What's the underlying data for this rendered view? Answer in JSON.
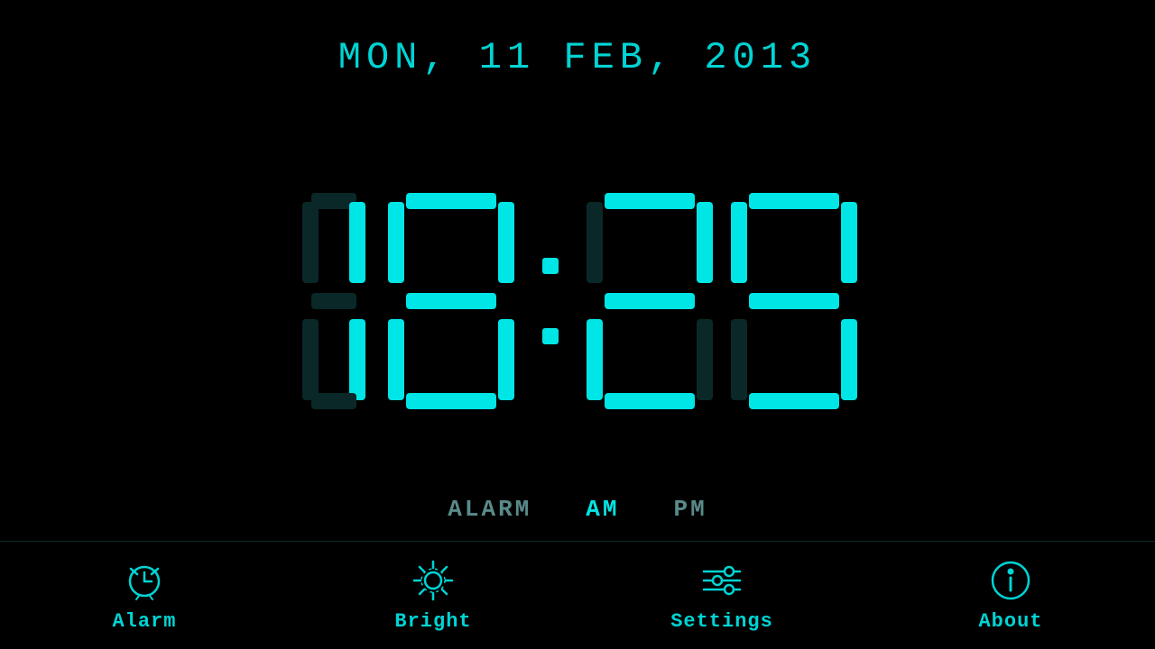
{
  "header": {
    "date": "MON,  11 FEB,  2013"
  },
  "clock": {
    "time": "18:29",
    "digits": [
      "1",
      "8",
      "2",
      "9"
    ]
  },
  "indicators": {
    "alarm_label": "ALARM",
    "am_label": "AM",
    "am_active": true,
    "pm_label": "PM",
    "pm_active": false
  },
  "nav": {
    "items": [
      {
        "id": "alarm",
        "label": "Alarm",
        "icon": "alarm-clock-icon"
      },
      {
        "id": "bright",
        "label": "Bright",
        "icon": "brightness-icon"
      },
      {
        "id": "settings",
        "label": "Settings",
        "icon": "settings-icon"
      },
      {
        "id": "about",
        "label": "About",
        "icon": "info-icon"
      }
    ]
  },
  "colors": {
    "active": "#00e5e5",
    "inactive": "#5a8a8a",
    "background": "#000000"
  }
}
